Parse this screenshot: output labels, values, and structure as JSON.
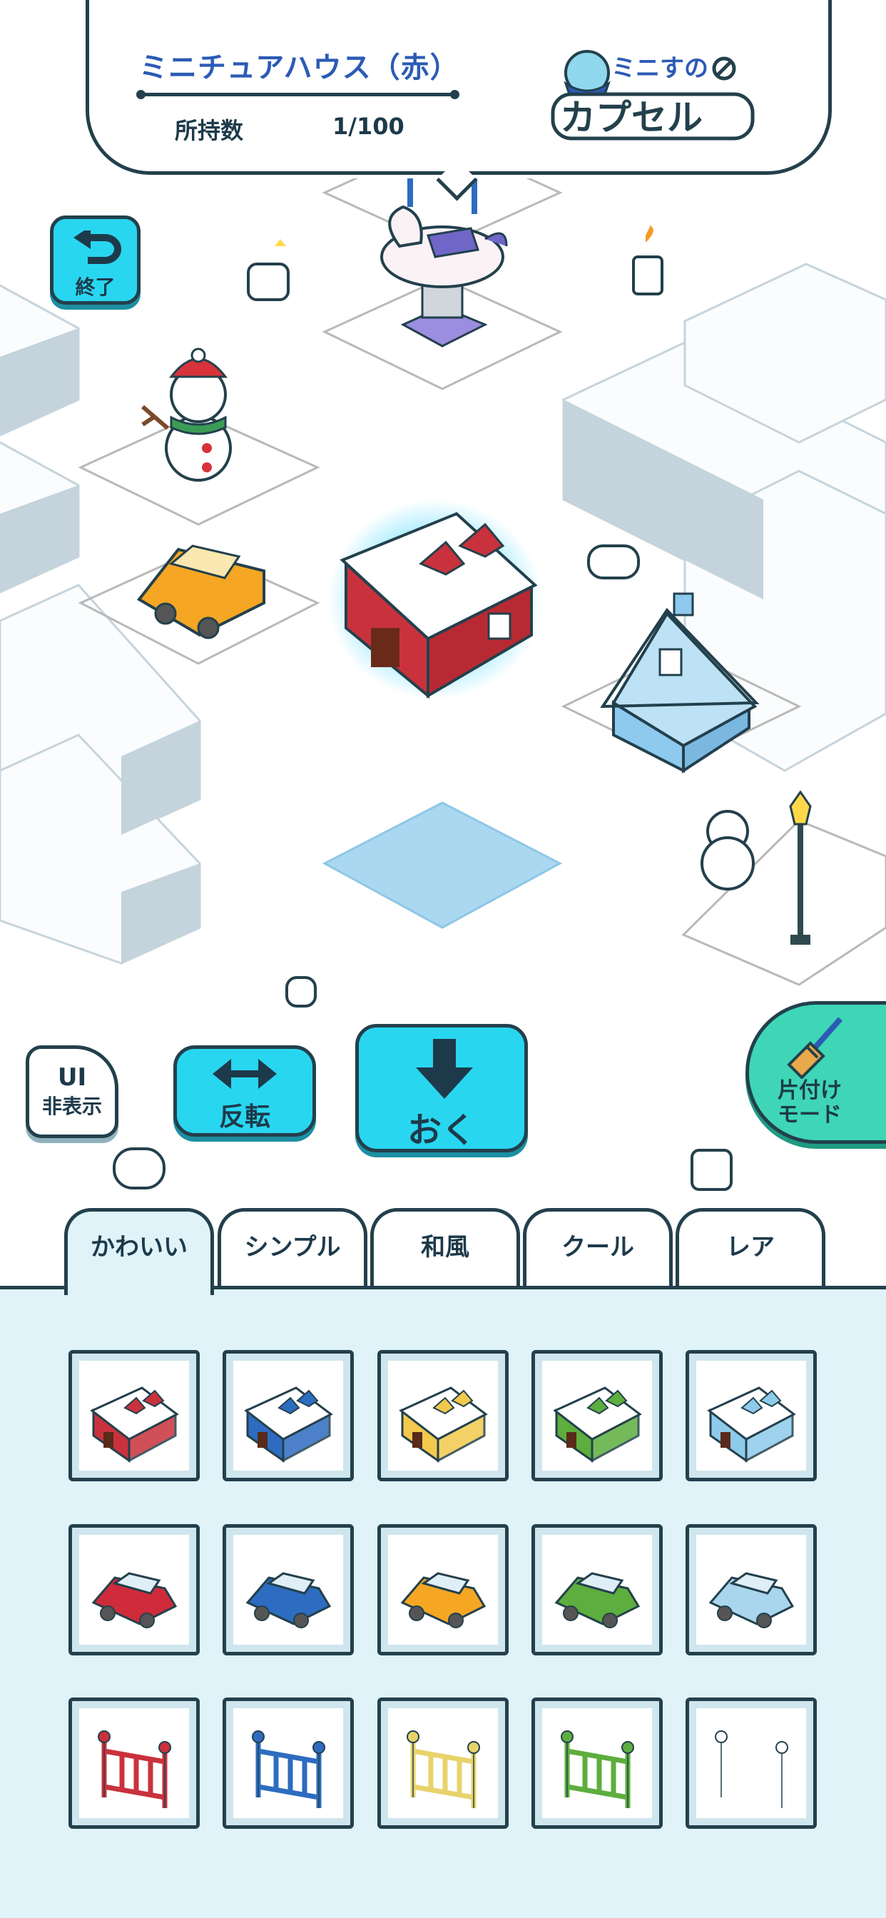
{
  "header": {
    "item_name": "ミニチュアハウス（赤）",
    "owned_label": "所持数",
    "owned_count": "1/100",
    "logo_line1": "ミニすの",
    "logo_line2": "カプセル"
  },
  "controls": {
    "exit_label": "終了",
    "ui_hide_label_1": "UI",
    "ui_hide_label_2": "非表示",
    "flip_label": "反転",
    "place_label": "おく",
    "tidy_label_1": "片付け",
    "tidy_label_2": "モード"
  },
  "tabs": [
    {
      "label": "かわいい",
      "active": true
    },
    {
      "label": "シンプル",
      "active": false
    },
    {
      "label": "和風",
      "active": false
    },
    {
      "label": "クール",
      "active": false
    },
    {
      "label": "レア",
      "active": false
    }
  ],
  "catalog": {
    "house_colors": [
      "#c9323c",
      "#2d6cc0",
      "#f2c94c",
      "#5dae3e",
      "#8ecbea"
    ],
    "car_colors": [
      "#d02b3a",
      "#2d6cc0",
      "#f5a623",
      "#5dae3e",
      "#a9d6ee"
    ],
    "fence_colors": [
      "#c9323c",
      "#2d6cc0",
      "#e8d36b",
      "#5dae3e",
      "#ffffff"
    ]
  },
  "colors": {
    "accent": "#29d6f0",
    "tidy": "#3ed6b6",
    "outline": "#23404c",
    "panel": "#dff3f9"
  }
}
